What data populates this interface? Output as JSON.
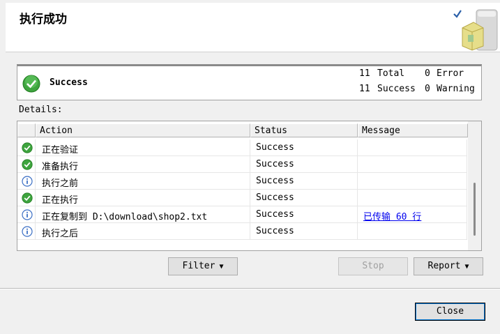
{
  "window": {
    "title": "执行成功"
  },
  "summary": {
    "status_label": "Success",
    "total_count": "11",
    "total_label": "Total",
    "success_count": "11",
    "success_label": "Success",
    "error_count": "0",
    "error_label": "Error",
    "warning_count": "0",
    "warning_label": "Warning"
  },
  "details": {
    "label": "Details:",
    "columns": [
      "Action",
      "Status",
      "Message"
    ],
    "rows": [
      {
        "icon": "success-icon",
        "action": "正在验证",
        "status": "Success",
        "message": ""
      },
      {
        "icon": "success-icon",
        "action": "准备执行",
        "status": "Success",
        "message": ""
      },
      {
        "icon": "info-icon",
        "action": "执行之前",
        "status": "Success",
        "message": ""
      },
      {
        "icon": "success-icon",
        "action": "正在执行",
        "status": "Success",
        "message": ""
      },
      {
        "icon": "info-icon",
        "action": "正在复制到 D:\\download\\shop2.txt",
        "status": "Success",
        "message": "已传输 60 行"
      },
      {
        "icon": "info-icon",
        "action": "执行之后",
        "status": "Success",
        "message": ""
      }
    ]
  },
  "buttons": {
    "filter": "Filter",
    "stop": "Stop",
    "report": "Report",
    "close": "Close"
  },
  "colors": {
    "success_green": "#3ea43e",
    "info_blue": "#3b6fc4",
    "link": "#0000ee"
  }
}
